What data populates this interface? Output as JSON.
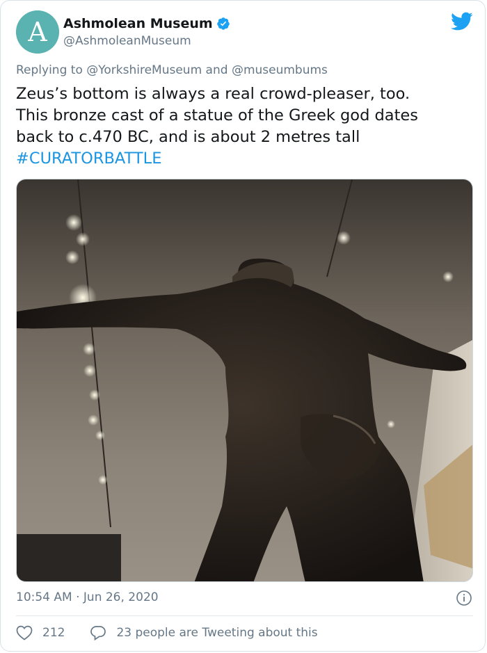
{
  "account": {
    "display_name": "Ashmolean Museum",
    "handle": "@AshmoleanMuseum",
    "avatar_letter": "A",
    "avatar_color": "#5ab3b0"
  },
  "reply": {
    "prefix": "Replying to ",
    "user1": "@YorkshireMuseum",
    "joiner": " and ",
    "user2": "@museumbums"
  },
  "tweet": {
    "line1": "Zeus’s bottom is always a real crowd-pleaser, too.",
    "line2": "This bronze cast of a statue of the Greek god dates",
    "line3": "back to c.470 BC, and is about 2 metres tall",
    "hashtag": "#CURATORBATTLE"
  },
  "meta": {
    "timestamp": "10:54 AM · Jun 26, 2020"
  },
  "actions": {
    "likes": "212",
    "conversation": "23 people are Tweeting about this"
  },
  "colors": {
    "link": "#1b95e0",
    "muted": "#657786",
    "twitter_blue": "#1da1f2"
  },
  "icons": {
    "verified": "verified-badge-icon",
    "logo": "twitter-bird-icon",
    "info": "info-icon",
    "like": "heart-icon",
    "reply": "speech-bubble-icon"
  }
}
